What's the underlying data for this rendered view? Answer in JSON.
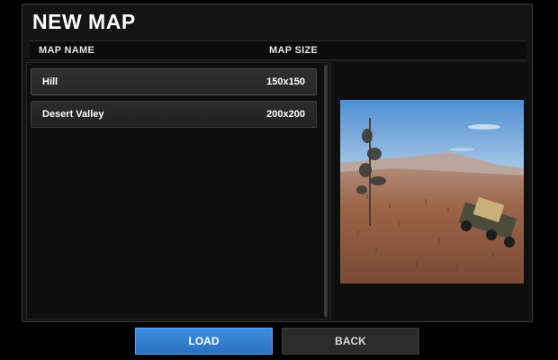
{
  "dialog": {
    "title": "NEW MAP",
    "columns": {
      "name": "MAP NAME",
      "size": "MAP SIZE"
    }
  },
  "maps": [
    {
      "name": "Hill",
      "size": "150x150"
    },
    {
      "name": "Desert Valley",
      "size": "200x200"
    }
  ],
  "buttons": {
    "load": "LOAD",
    "back": "BACK"
  },
  "colors": {
    "accent": "#3f8fe0",
    "panel": "#141414",
    "sky": "#5d9ad8",
    "ground": "#9a6448"
  }
}
